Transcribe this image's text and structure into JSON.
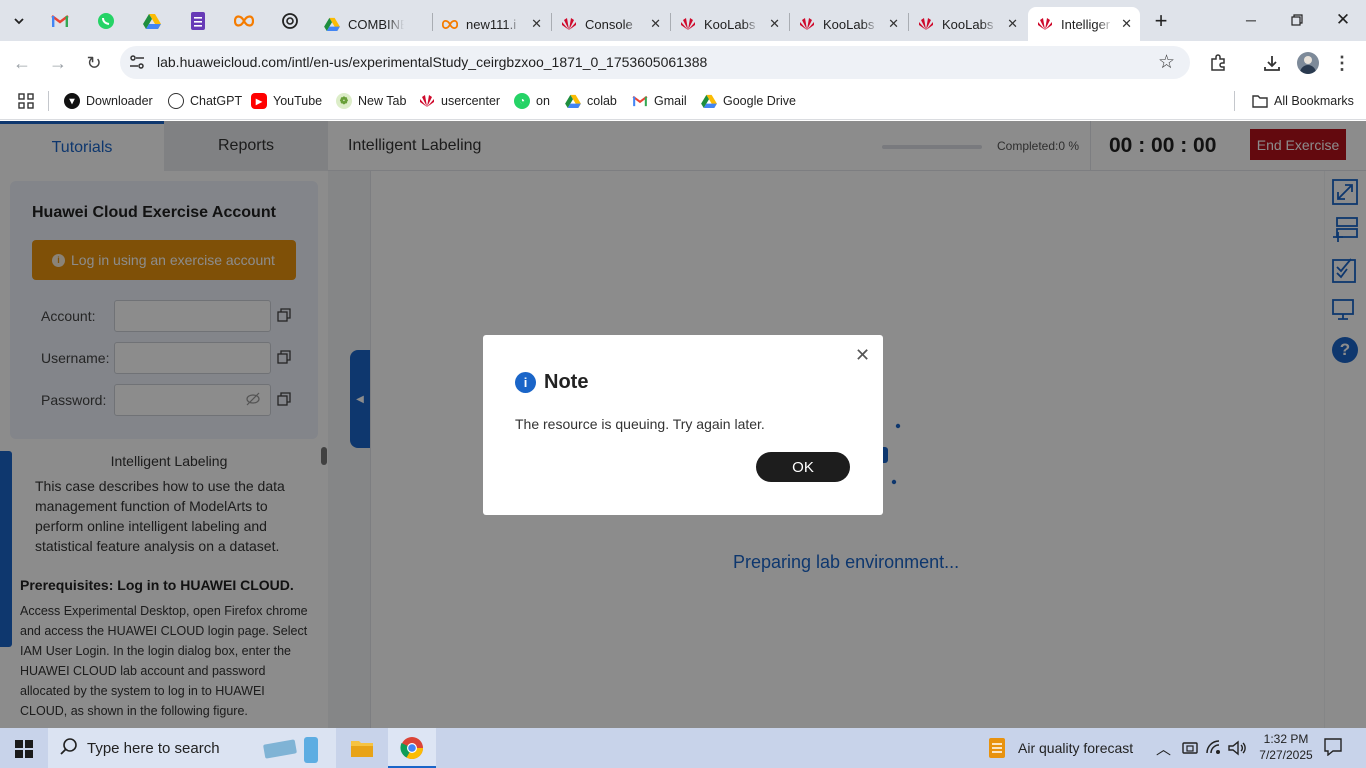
{
  "browser": {
    "pinned_tabs": [
      "tab-menu",
      "gmail",
      "whatsapp",
      "drive",
      "forms",
      "infinity",
      "chatgpt"
    ],
    "tabs": [
      {
        "title": "COMBINE",
        "icon": "drive-icon"
      },
      {
        "title": "new111.i",
        "icon": "infinity-icon"
      },
      {
        "title": "Console",
        "icon": "huawei-icon"
      },
      {
        "title": "KooLabs",
        "icon": "huawei-icon"
      },
      {
        "title": "KooLabs",
        "icon": "huawei-icon"
      },
      {
        "title": "KooLabs",
        "icon": "huawei-icon"
      },
      {
        "title": "Intelliger",
        "icon": "huawei-icon",
        "active": true
      }
    ],
    "url": "lab.huaweicloud.com/intl/en-us/experimentalStudy_ceirgbzxoo_1871_0_1753605061388",
    "bookmarks": [
      "Downloader",
      "ChatGPT",
      "YouTube",
      "New Tab",
      "usercenter",
      "on",
      "colab",
      "Gmail",
      "Google Drive"
    ],
    "all_bookmarks": "All Bookmarks"
  },
  "app": {
    "tabs": {
      "tutorials": "Tutorials",
      "reports": "Reports"
    },
    "title": "Intelligent Labeling",
    "completed": "Completed:0 %",
    "timer": "00 : 00 : 00",
    "end_button": "End Exercise",
    "account_panel": {
      "title": "Huawei Cloud Exercise Account",
      "login_button": "Log in using an exercise account",
      "fields": {
        "account": "Account:",
        "username": "Username:",
        "password": "Password:"
      }
    },
    "tutorial": {
      "heading": "Intelligent Labeling",
      "intro": "This case describes how to use the data management function of ModelArts to perform online intelligent labeling and statistical feature analysis on a dataset.",
      "prereq_title": "Prerequisites: Log in to HUAWEI CLOUD.",
      "prereq_body": "Access Experimental Desktop,  open Firefox chrome and access the HUAWEI CLOUD login page. Select IAM User Login. In the login dialog box, enter the HUAWEI CLOUD lab account and password allocated by the system to log in to HUAWEI CLOUD, as shown in the following figure."
    },
    "status": "Preparing lab environment...",
    "colors": {
      "end_btn": "#b5121b",
      "login_btn": "#e8920e",
      "accent": "#1a65c8"
    }
  },
  "dialog": {
    "title": "Note",
    "message": "The resource is queuing. Try again later.",
    "ok": "OK"
  },
  "taskbar": {
    "search_placeholder": "Type here to search",
    "weather": "Air quality forecast",
    "time": "1:32 PM",
    "date": "7/27/2025"
  }
}
